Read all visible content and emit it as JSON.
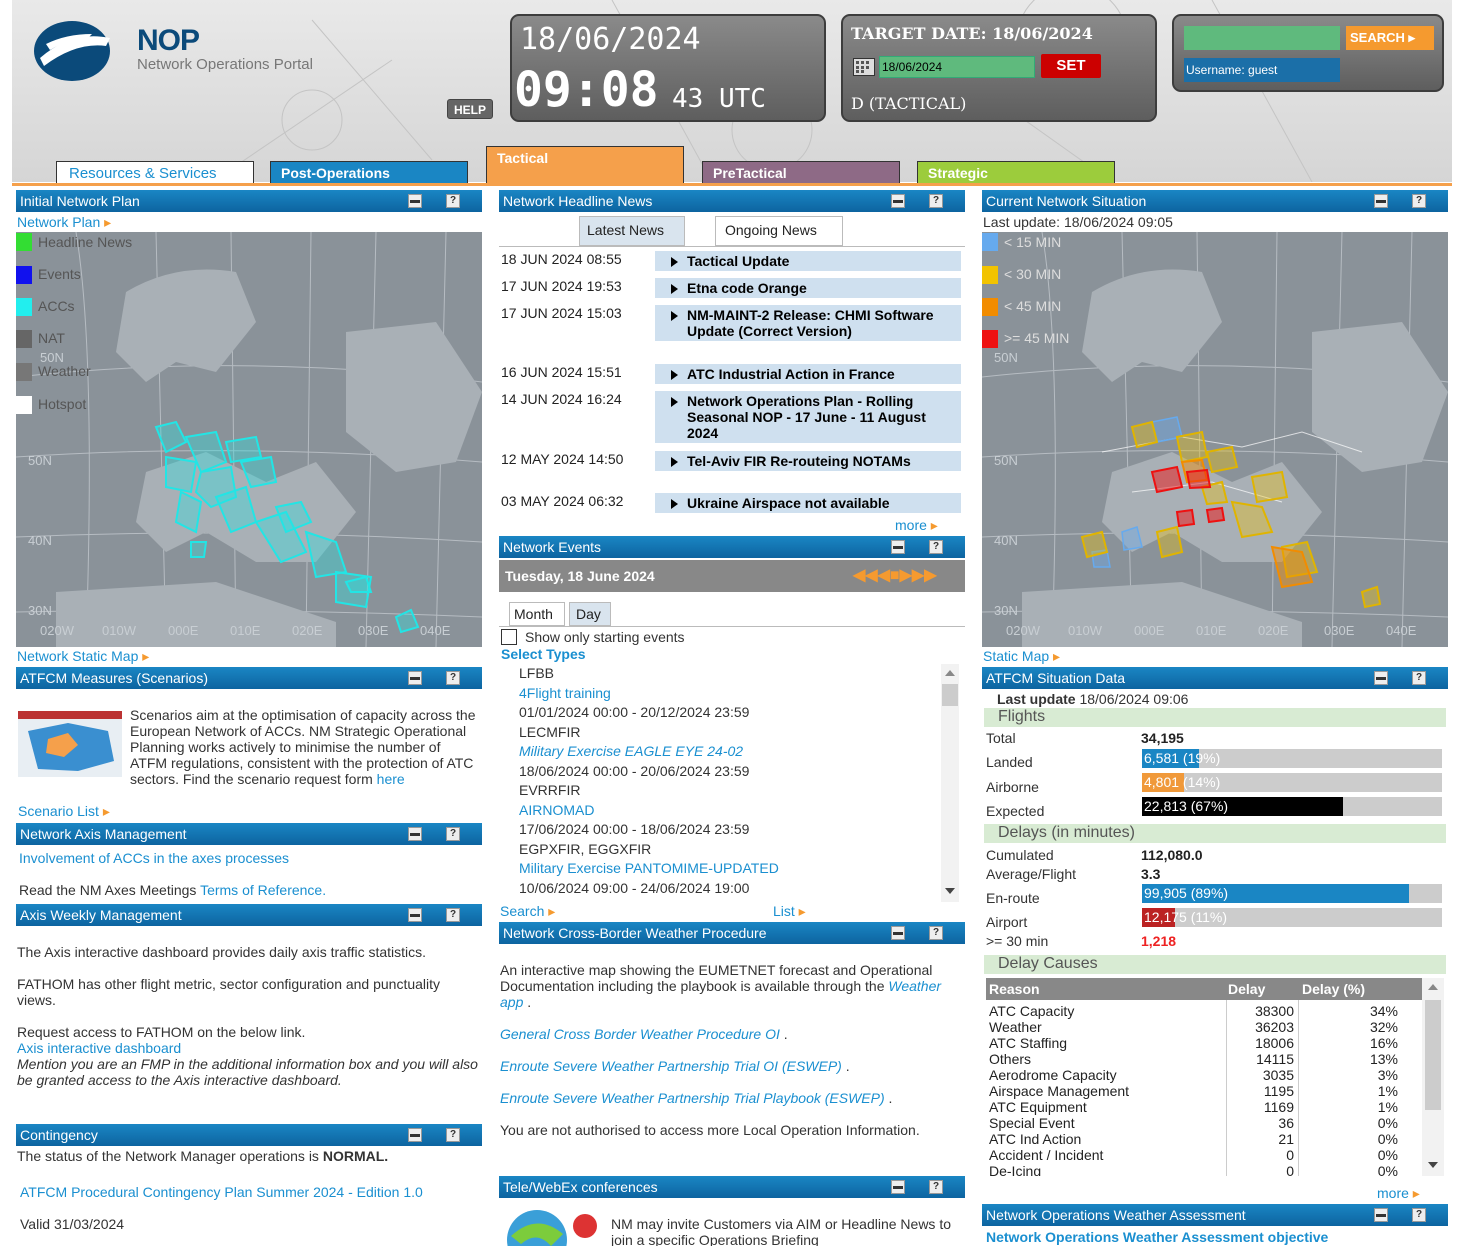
{
  "header": {
    "logo_text": "NOP",
    "logo_subtitle": "Network Operations Portal",
    "help_label": "HELP",
    "clock_date": "18/06/2024",
    "clock_time": "09:08",
    "clock_seconds": "43 UTC",
    "target_label": "TARGET DATE: 18/06/2024",
    "target_input_value": "18/06/2024",
    "set_label": "SET",
    "phase_label": "D (TACTICAL)",
    "search_label": "SEARCH",
    "username_label": "Username: guest"
  },
  "tabs": [
    {
      "label": "Resources & Services",
      "color": "#ffffff"
    },
    {
      "label": "Post-Operations",
      "color": "#1a86c4"
    },
    {
      "label": "Tactical",
      "color": "#f5a04b"
    },
    {
      "label": "PreTactical",
      "color": "#8e6a86"
    },
    {
      "label": "Strategic",
      "color": "#9ccc3c"
    }
  ],
  "inp": {
    "title": "Initial Network Plan",
    "link": "Network Plan",
    "legend": [
      {
        "label": "Headline News",
        "color": "#33dd33"
      },
      {
        "label": "Events",
        "color": "#1111ee"
      },
      {
        "label": "ACCs",
        "color": "#22eeee"
      },
      {
        "label": "NAT",
        "color": "#666666"
      },
      {
        "label": "Weather",
        "color": "#777777"
      },
      {
        "label": "Hotspot",
        "color": "#ffffff"
      }
    ],
    "lat_labels": [
      "50N",
      "50N",
      "40N",
      "30N"
    ],
    "lon_labels": [
      "020W",
      "010W",
      "000E",
      "010E",
      "020E",
      "030E",
      "040E"
    ],
    "static_map_link": "Network Static Map"
  },
  "atfcm": {
    "title": "ATFCM Measures (Scenarios)",
    "text": "Scenarios aim at the optimisation of capacity across the European Network of ACCs. NM Strategic Operational Planning works actively to minimise the number of ATFM regulations, consistent with the protection of ATC sectors.",
    "text2": "Find the scenario request form",
    "here": "here",
    "scenario_list": "Scenario List"
  },
  "axis": {
    "title": "Network Axis Management",
    "link": "Involvement of ACCs in the axes processes",
    "text": "Read the NM Axes Meetings",
    "terms_link": "Terms of Reference."
  },
  "weekly": {
    "title": "Axis Weekly Management",
    "p1": "The Axis interactive dashboard provides daily axis traffic statistics.",
    "p2": "FATHOM has other flight metric, sector configuration and punctuality views.",
    "p3": "Request access to FATHOM on the below link.",
    "link": "Axis interactive dashboard",
    "note": "Mention you are an FMP in the additional information box and you will also be granted access to the Axis interactive dashboard."
  },
  "contingency": {
    "title": "Contingency",
    "text_prefix": "The status of the Network Manager operations is",
    "status": "NORMAL.",
    "link": "ATFCM Procedural Contingency Plan Summer 2024 - Edition 1.0",
    "valid": "Valid 31/03/2024"
  },
  "news": {
    "title": "Network Headline News",
    "tab_latest": "Latest News",
    "tab_ongoing": "Ongoing News",
    "items": [
      {
        "date": "18 JUN 2024 08:55",
        "title": "Tactical Update"
      },
      {
        "date": "17 JUN 2024 19:53",
        "title": "Etna code Orange"
      },
      {
        "date": "17 JUN 2024 15:03",
        "title": "NM-MAINT-2 Release: CHMI Software Update (Correct Version)"
      },
      {
        "date": "16 JUN 2024 15:51",
        "title": "ATC Industrial Action in France"
      },
      {
        "date": "14 JUN 2024 16:24",
        "title": "Network Operations Plan - Rolling Seasonal NOP - 17 June - 11 August 2024"
      },
      {
        "date": "12 MAY 2024 14:50",
        "title": "Tel-Aviv FIR Re-routeing NOTAMs"
      },
      {
        "date": "03 MAY 2024 06:32",
        "title": "Ukraine Airspace not available"
      }
    ],
    "more": "more"
  },
  "events": {
    "title": "Network Events",
    "date": "Tuesday, 18 June 2024",
    "tab_month": "Month",
    "tab_day": "Day",
    "checkbox_label": "Show only starting events",
    "select_types": "Select Types",
    "items": [
      {
        "loc": "LFBB",
        "name": "4Flight training",
        "italic": false,
        "range": "01/01/2024 00:00 - 20/12/2024 23:59"
      },
      {
        "loc": "LECMFIR",
        "name": "Military Exercise EAGLE EYE 24-02",
        "italic": true,
        "range": "18/06/2024 00:00 - 20/06/2024 23:59"
      },
      {
        "loc": "EVRRFIR",
        "name": "AIRNOMAD",
        "italic": false,
        "range": "17/06/2024 00:00 - 18/06/2024 23:59"
      },
      {
        "loc": "EGPXFIR, EGGXFIR",
        "name": "Military Exercise PANTOMIME-UPDATED",
        "italic": false,
        "range": "10/06/2024 09:00 - 24/06/2024 19:00"
      }
    ],
    "search": "Search",
    "list": "List"
  },
  "weather": {
    "title": "Network Cross-Border Weather Procedure",
    "p1": "An interactive map showing the EUMETNET forecast and Operational Documentation including the playbook is available through the",
    "app_link": "Weather app",
    "links": [
      "General Cross Border Weather Procedure OI",
      "Enroute Severe Weather Partnership Trial OI (ESWEP)",
      "Enroute Severe Weather Partnership Trial Playbook (ESWEP)"
    ],
    "p2": "You are not authorised to access more Local Operation Information."
  },
  "webex": {
    "title": "Tele/WebEx conferences",
    "text": "NM may invite Customers via AIM or Headline News to join a specific Operations Briefing"
  },
  "cns": {
    "title": "Current Network Situation",
    "last_update": "Last update: 18/06/2024 09:05",
    "legend": [
      {
        "label": "< 15 MIN",
        "color": "#66aaee"
      },
      {
        "label": "< 30 MIN",
        "color": "#f2c300"
      },
      {
        "label": "< 45 MIN",
        "color": "#f28c00"
      },
      {
        "label": ">= 45 MIN",
        "color": "#ee1111"
      }
    ],
    "static_map_link": "Static Map"
  },
  "situation": {
    "title": "ATFCM Situation Data",
    "last_update_label": "Last update",
    "last_update": "18/06/2024 09:06",
    "flights_header": "Flights",
    "total_label": "Total",
    "total": "34,195",
    "landed_label": "Landed",
    "landed": "6,581 (19%)",
    "landed_frac": 0.19,
    "airborne_label": "Airborne",
    "airborne": "4,801 (14%)",
    "airborne_frac": 0.14,
    "expected_label": "Expected",
    "expected": "22,813 (67%)",
    "expected_frac": 0.67,
    "delays_header": "Delays (in minutes)",
    "cumulated_label": "Cumulated",
    "cumulated": "112,080.0",
    "avg_label": "Average/Flight",
    "avg": "3.3",
    "enroute_label": "En-route",
    "enroute": "99,905 (89%)",
    "enroute_frac": 0.89,
    "airport_label": "Airport",
    "airport": "12,175 (11%)",
    "airport_frac": 0.11,
    "over30_label": ">= 30 min",
    "over30": "1,218",
    "causes_header": "Delay Causes",
    "col_reason": "Reason",
    "col_delay": "Delay",
    "col_pct": "Delay (%)",
    "causes": [
      {
        "reason": "ATC Capacity",
        "delay": "38300",
        "pct": "34%"
      },
      {
        "reason": "Weather",
        "delay": "36203",
        "pct": "32%"
      },
      {
        "reason": "ATC Staffing",
        "delay": "18006",
        "pct": "16%"
      },
      {
        "reason": "Others",
        "delay": "14115",
        "pct": "13%"
      },
      {
        "reason": "Aerodrome Capacity",
        "delay": "3035",
        "pct": "3%"
      },
      {
        "reason": "Airspace Management",
        "delay": "1195",
        "pct": "1%"
      },
      {
        "reason": "ATC Equipment",
        "delay": "1169",
        "pct": "1%"
      },
      {
        "reason": "Special Event",
        "delay": "36",
        "pct": "0%"
      },
      {
        "reason": "ATC Ind Action",
        "delay": "21",
        "pct": "0%"
      },
      {
        "reason": "Accident / Incident",
        "delay": "0",
        "pct": "0%"
      },
      {
        "reason": "De-Icing",
        "delay": "0",
        "pct": "0%"
      }
    ],
    "more": "more"
  },
  "nowa": {
    "title": "Network Operations Weather Assessment",
    "link": "Network Operations Weather Assessment objective"
  }
}
